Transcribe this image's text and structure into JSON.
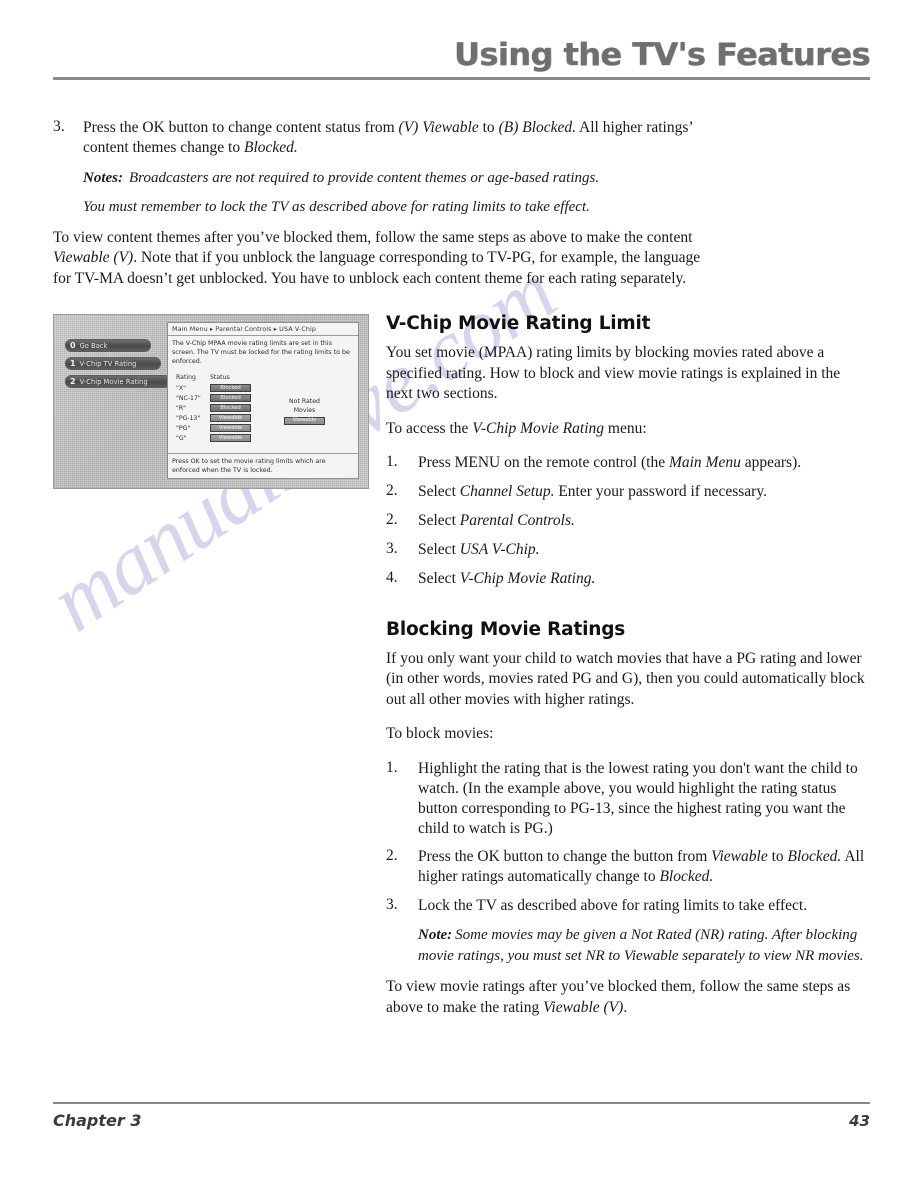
{
  "header": {
    "title": "Using the TV's Features"
  },
  "top_section": {
    "step3": {
      "number": "3.",
      "text_parts": [
        {
          "t": "Press the OK button to change content status from ",
          "style": "normal"
        },
        {
          "t": "(V) Viewable",
          "style": "italic"
        },
        {
          "t": " to ",
          "style": "normal"
        },
        {
          "t": "(B) Blocked.",
          "style": "italic"
        },
        {
          "t": " All higher ratings' content themes change to ",
          "style": "normal"
        },
        {
          "t": "Blocked.",
          "style": "italic"
        }
      ],
      "full_text": "Press the OK button to change content status from (V) Viewable to (B) Blocked. All higher ratings' content themes change to Blocked."
    },
    "notes_label": "Notes:",
    "note_1": "Broadcasters are not required to provide content themes or age-based ratings.",
    "note_2": "You must remember to lock the TV as described above for rating limits to take effect.",
    "paragraph": "To view content themes after you've blocked them, follow the same steps as above to make the content Viewable (V). Note that if you unblock the language corresponding to TV-PG, for example, the language for TV-MA doesn't get unblocked. You have to unblock each content theme for each rating separately."
  },
  "tv_figure": {
    "buttons": [
      {
        "number": "0",
        "label": "Go Back"
      },
      {
        "number": "1",
        "label": "V-Chip TV Rating"
      },
      {
        "number": "2",
        "label": "V-Chip Movie Rating"
      }
    ],
    "breadcrumb": "Main Menu ▸ Parental Controls ▸ USA V-Chip",
    "description": "The V-Chip MPAA movie rating limits are set in this screen. The TV must be locked for the rating limits to be enforced.",
    "table": {
      "headers": [
        "Rating",
        "Status"
      ],
      "rows": [
        {
          "rating": "\"X\"",
          "status": "Blocked"
        },
        {
          "rating": "\"NC-17\"",
          "status": "Blocked"
        },
        {
          "rating": "\"R\"",
          "status": "Blocked"
        },
        {
          "rating": "\"PG-13\"",
          "status": "Viewable"
        },
        {
          "rating": "\"PG\"",
          "status": "Viewable"
        },
        {
          "rating": "\"G\"",
          "status": "Viewable"
        }
      ]
    },
    "not_rated": {
      "line1": "Not Rated",
      "line2": "Movies",
      "status": "Viewable"
    },
    "footnote": "Press OK to set the movie rating limits which are enforced when the TV is locked."
  },
  "right_column": {
    "section1": {
      "heading": "V-Chip Movie Rating Limit",
      "intro": "You set movie (MPAA) rating limits by blocking movies rated above a specified rating. How to block and view movie ratings is explained in the next two sections.",
      "access_lead": "To access the V-Chip Movie Rating menu:",
      "steps": [
        {
          "number": "1.",
          "text": "Press MENU on the remote control (the Main Menu appears)."
        },
        {
          "number": "2.",
          "text": "Select Channel Setup. Enter your password if necessary."
        },
        {
          "number": "2.",
          "text": "Select Parental Controls."
        },
        {
          "number": "3.",
          "text": "Select USA V-Chip."
        },
        {
          "number": "4.",
          "text": "Select V-Chip Movie Rating."
        }
      ]
    },
    "section2": {
      "heading": "Blocking Movie Ratings",
      "intro": "If you only want your child to watch movies that have a PG rating and lower (in other words, movies rated PG and G), then you could automatically block out all other movies with higher ratings.",
      "block_lead": "To block movies:",
      "steps": [
        {
          "number": "1.",
          "text": "Highlight the rating that is the lowest rating you don't want the child to watch. (In the example above, you would highlight the rating status button corresponding to PG-13, since the highest rating you want the child to watch is PG.)"
        },
        {
          "number": "2.",
          "text": "Press the OK button to change the button from Viewable to Blocked. All higher ratings automatically change to Blocked."
        },
        {
          "number": "3.",
          "text": "Lock the TV as described above for rating limits to take effect."
        }
      ],
      "note_label": "Note:",
      "note_text": "Some movies may be given a Not Rated (NR) rating. After blocking movie ratings, you must set NR to Viewable separately to view NR movies.",
      "closing": "To view movie ratings after you've blocked them, follow the same steps as above to make the rating Viewable (V)."
    }
  },
  "footer": {
    "chapter": "Chapter 3",
    "page_number": "43"
  },
  "watermark": {
    "text": "manualshive.com",
    "color": "#c9c6e6"
  }
}
